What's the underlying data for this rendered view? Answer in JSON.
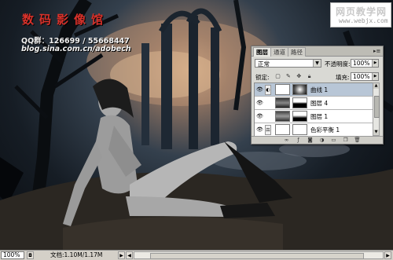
{
  "canvas": {
    "watermark": {
      "title": "数码影像馆",
      "qq": "QQ群：126699 / 55668447",
      "blog": "blog.sina.com.cn/adobech"
    },
    "site_badge": {
      "main": "网页教学网",
      "url": "www.webjx.com"
    }
  },
  "layers_panel": {
    "tabs": [
      "图层",
      "通道",
      "路径"
    ],
    "blend_mode": "正常",
    "opacity_label": "不透明度:",
    "opacity_value": "100%",
    "lock_label": "锁定:",
    "fill_label": "填充:",
    "fill_value": "100%",
    "layers": [
      {
        "name": "曲线 1",
        "selected": true
      },
      {
        "name": "图层 4",
        "selected": false
      },
      {
        "name": "图层 1",
        "selected": false
      },
      {
        "name": "色彩平衡 1",
        "selected": false
      }
    ]
  },
  "status_bar": {
    "zoom": "100%",
    "doc_info": "文档:1.10M/1.17M"
  }
}
